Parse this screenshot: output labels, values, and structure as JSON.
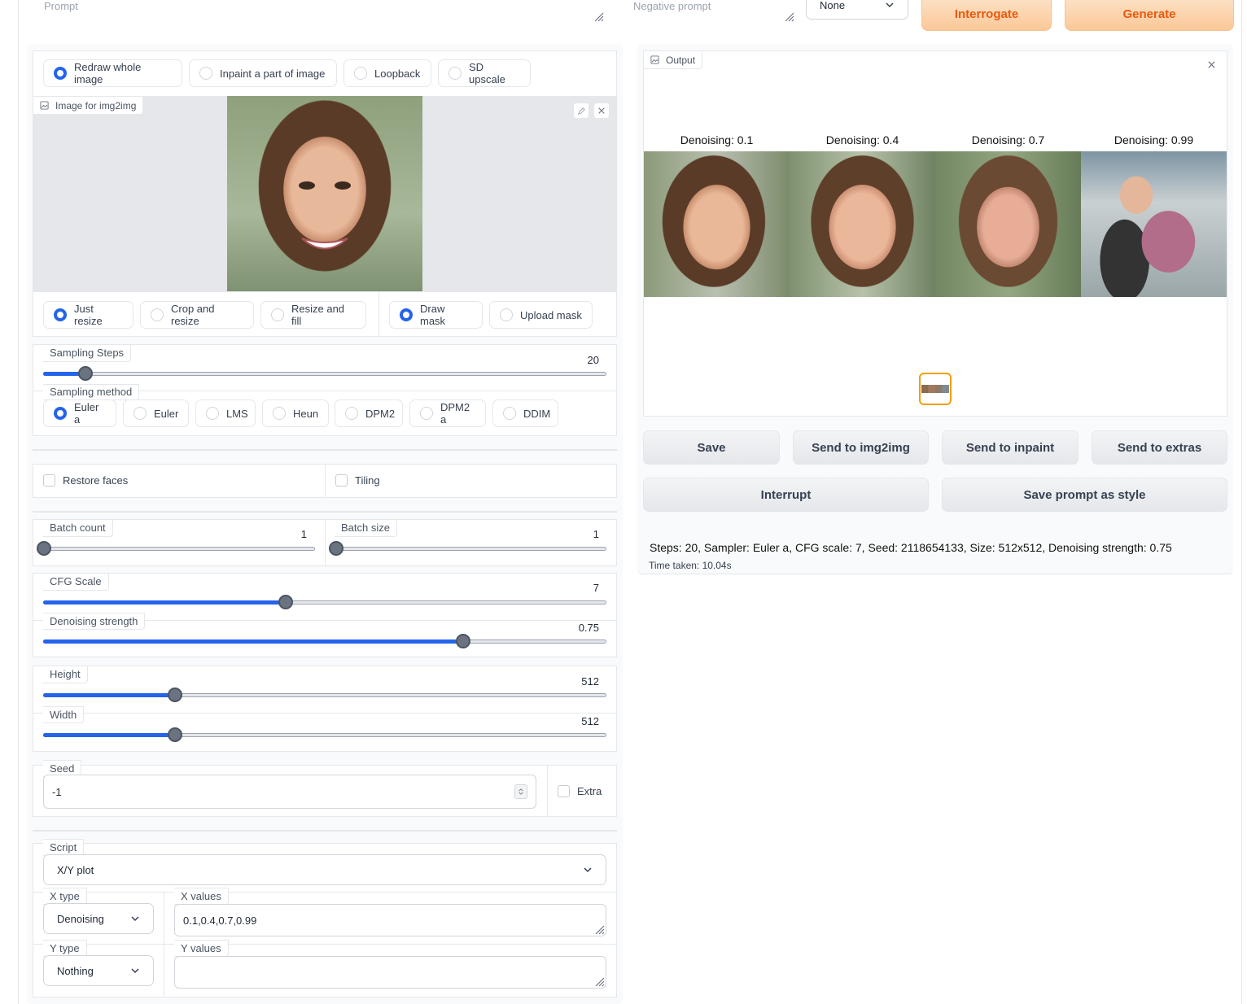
{
  "top": {
    "prompt_placeholder": "Prompt",
    "negative_placeholder": "Negative prompt",
    "style_selected": "None",
    "interrogate_label": "Interrogate",
    "generate_label": "Generate"
  },
  "mode_tabs": [
    {
      "label": "Redraw whole image",
      "selected": true
    },
    {
      "label": "Inpaint a part of image",
      "selected": false
    },
    {
      "label": "Loopback",
      "selected": false
    },
    {
      "label": "SD upscale",
      "selected": false
    }
  ],
  "image_input": {
    "label": "Image for img2img"
  },
  "resize_modes": [
    {
      "label": "Just resize",
      "selected": true
    },
    {
      "label": "Crop and resize",
      "selected": false
    },
    {
      "label": "Resize and fill",
      "selected": false
    }
  ],
  "mask_modes": [
    {
      "label": "Draw mask",
      "selected": true
    },
    {
      "label": "Upload mask",
      "selected": false
    }
  ],
  "sampling_steps": {
    "label": "Sampling Steps",
    "value": "20",
    "fraction": 0.075
  },
  "sampling_method": {
    "label": "Sampling method",
    "options": [
      {
        "label": "Euler a",
        "selected": true
      },
      {
        "label": "Euler",
        "selected": false
      },
      {
        "label": "LMS",
        "selected": false
      },
      {
        "label": "Heun",
        "selected": false
      },
      {
        "label": "DPM2",
        "selected": false
      },
      {
        "label": "DPM2 a",
        "selected": false
      },
      {
        "label": "DDIM",
        "selected": false
      }
    ]
  },
  "checks": {
    "restore_faces": "Restore faces",
    "tiling": "Tiling",
    "extra": "Extra"
  },
  "batch_count": {
    "label": "Batch count",
    "value": "1",
    "fraction": 0.0
  },
  "batch_size": {
    "label": "Batch size",
    "value": "1",
    "fraction": 0.0
  },
  "cfg_scale": {
    "label": "CFG Scale",
    "value": "7",
    "fraction": 0.43
  },
  "denoising": {
    "label": "Denoising strength",
    "value": "0.75",
    "fraction": 0.745
  },
  "height": {
    "label": "Height",
    "value": "512",
    "fraction": 0.234
  },
  "width": {
    "label": "Width",
    "value": "512",
    "fraction": 0.234
  },
  "seed": {
    "label": "Seed",
    "value": "-1"
  },
  "script": {
    "label": "Script",
    "selected": "X/Y plot"
  },
  "xy": {
    "x_type_label": "X type",
    "x_type_value": "Denoising",
    "x_values_label": "X values",
    "x_values": "0.1,0.4,0.7,0.99",
    "y_type_label": "Y type",
    "y_type_value": "Nothing",
    "y_values_label": "Y values",
    "y_values": ""
  },
  "output": {
    "label": "Output",
    "columns": [
      "Denoising: 0.1",
      "Denoising: 0.4",
      "Denoising: 0.7",
      "Denoising: 0.99"
    ]
  },
  "actions": {
    "save": "Save",
    "send_img2img": "Send to img2img",
    "send_inpaint": "Send to inpaint",
    "send_extras": "Send to extras",
    "interrupt": "Interrupt",
    "save_style": "Save prompt as style"
  },
  "info": {
    "params": "Steps: 20, Sampler: Euler a, CFG scale: 7, Seed: 2118654133, Size: 512x512, Denoising strength: 0.75",
    "time": "Time taken: 10.04s"
  },
  "colors": {
    "accent": "#2563eb",
    "orange": "#ea580c"
  }
}
